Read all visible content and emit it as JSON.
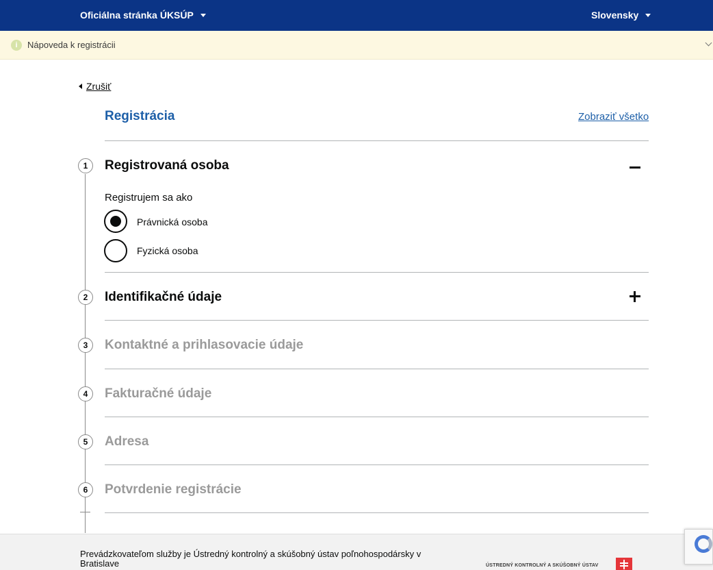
{
  "topbar": {
    "official_prefix": "Oficiálna stránka",
    "official_strong": "ÚKSÚP",
    "language": "Slovensky"
  },
  "helpbar": {
    "label": "Nápoveda k registrácii"
  },
  "back_link": "Zrušiť",
  "page_title": "Registrácia",
  "show_all": "Zobraziť všetko",
  "steps": [
    {
      "number": "1",
      "title": "Registrovaná osoba",
      "state": "expanded"
    },
    {
      "number": "2",
      "title": "Identifikačné údaje",
      "state": "collapsed"
    },
    {
      "number": "3",
      "title": "Kontaktné a prihlasovacie údaje",
      "state": "disabled"
    },
    {
      "number": "4",
      "title": "Fakturačné údaje",
      "state": "disabled"
    },
    {
      "number": "5",
      "title": "Adresa",
      "state": "disabled"
    },
    {
      "number": "6",
      "title": "Potvrdenie registrácie",
      "state": "disabled"
    }
  ],
  "registration_type": {
    "legend": "Registrujem sa ako",
    "options": [
      {
        "label": "Právnická osoba",
        "checked": true
      },
      {
        "label": "Fyzická osoba",
        "checked": false
      }
    ]
  },
  "footer": {
    "operator_text": "Prevádzkovateľom služby je Ústredný kontrolný a skúšobný ústav poľnohospodársky v Bratislave",
    "org_name": "ÚSTREDNÝ KONTROLNÝ A SKÚŠOBNÝ ÚSTAV"
  },
  "colors": {
    "topbar": "#0b3486",
    "link": "#1d5fa8",
    "helpbar": "#fdf8e1",
    "footer": "#f2f2f2"
  }
}
